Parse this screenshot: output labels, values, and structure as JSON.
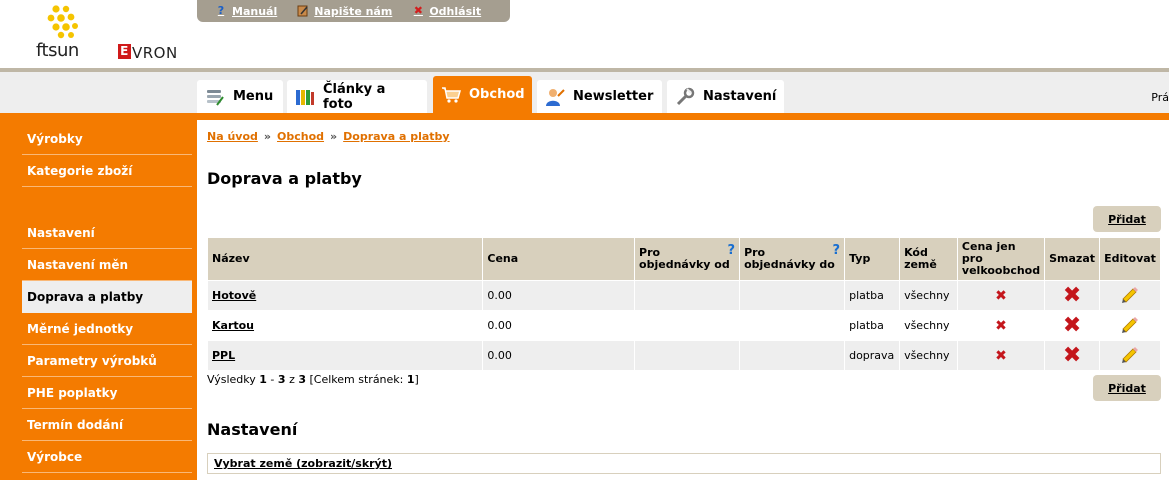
{
  "brand": {
    "logo1": "ftsun",
    "logo2_first": "E",
    "logo2_rest": "VRON"
  },
  "toplinks": [
    {
      "label": "Manuál",
      "icon": "help-icon"
    },
    {
      "label": "Napište nám",
      "icon": "write-icon"
    },
    {
      "label": "Odhlásit",
      "icon": "logout-icon"
    }
  ],
  "tabs": [
    {
      "label": "Menu",
      "icon": "menu-icon"
    },
    {
      "label": "Články a foto",
      "icon": "articles-icon"
    },
    {
      "label": "Obchod",
      "icon": "cart-icon",
      "active": true
    },
    {
      "label": "Newsletter",
      "icon": "newsletter-icon"
    },
    {
      "label": "Nastavení",
      "icon": "settings-icon"
    }
  ],
  "tabbar_right_text": "Prá",
  "sidebar": {
    "items": [
      {
        "label": "Výrobky"
      },
      {
        "label": "Kategorie zboží"
      },
      {
        "label": "Nastavení"
      },
      {
        "label": "Nastavení měn"
      },
      {
        "label": "Doprava a platby",
        "active": true
      },
      {
        "label": "Měrné jednotky"
      },
      {
        "label": "Parametry výrobků"
      },
      {
        "label": "PHE poplatky"
      },
      {
        "label": "Termín dodání"
      },
      {
        "label": "Výrobce"
      }
    ]
  },
  "breadcrumb": [
    "Na úvod",
    "Obchod",
    "Doprava a platby"
  ],
  "breadcrumb_sep": "»",
  "page_title": "Doprava a platby",
  "add_label": "Přidat",
  "table": {
    "headers": {
      "name": "Název",
      "price": "Cena",
      "orders_from": "Pro objednávky od",
      "orders_to": "Pro objednávky do",
      "type": "Typ",
      "country_code": "Kód země",
      "wholesale_only": "Cena jen pro velkoobchod",
      "delete": "Smazat",
      "edit": "Editovat"
    },
    "help_mark": "?",
    "rows": [
      {
        "name": "Hotově",
        "price": "0.00",
        "orders_from": "",
        "orders_to": "",
        "type": "platba",
        "country_code": "všechny"
      },
      {
        "name": "Kartou",
        "price": "0.00",
        "orders_from": "",
        "orders_to": "",
        "type": "platba",
        "country_code": "všechny"
      },
      {
        "name": "PPL",
        "price": "0.00",
        "orders_from": "",
        "orders_to": "",
        "type": "doprava",
        "country_code": "všechny"
      }
    ]
  },
  "results": {
    "prefix": "Výsledky",
    "from": "1",
    "dash": "-",
    "to": "3",
    "of_word": "z",
    "total": "3",
    "pages_prefix": "[Celkem stránek:",
    "pages": "1",
    "pages_suffix": "]"
  },
  "settings_title": "Nastavení",
  "select_country": "Vybrat země (zobrazit/skrýt)",
  "colors": {
    "accent": "#f47b00",
    "header_cell": "#d8d0bd",
    "toplinks_bg": "#a59e90",
    "link": "#e07000",
    "delete": "#c4161c"
  }
}
